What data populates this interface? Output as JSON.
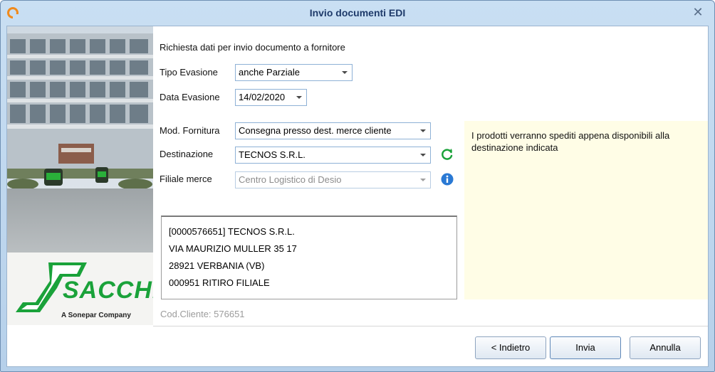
{
  "window": {
    "title": "Invio documenti EDI"
  },
  "form": {
    "heading": "Richiesta dati per invio documento a fornitore",
    "tipo_evasione": {
      "label": "Tipo Evasione",
      "value": "anche Parziale"
    },
    "data_evasione": {
      "label": "Data Evasione",
      "value": "14/02/2020"
    },
    "mod_fornitura": {
      "label": "Mod. Fornitura",
      "value": "Consegna presso dest. merce cliente"
    },
    "destinazione": {
      "label": "Destinazione",
      "value": "TECNOS S.R.L."
    },
    "filiale_merce": {
      "label": "Filiale merce",
      "value": "Centro Logistico di Desio"
    }
  },
  "info": {
    "text": "I prodotti verranno spediti appena disponibili alla destinazione indicata"
  },
  "address": {
    "line1": "[0000576651] TECNOS S.R.L.",
    "line2": "VIA MAURIZIO MULLER 35  17",
    "line3": "28921 VERBANIA (VB)",
    "line4": "000951 RITIRO FILIALE"
  },
  "cod_cliente": "Cod.Cliente: 576651",
  "logo": {
    "brand": "SACCHI",
    "tagline": "A Sonepar Company"
  },
  "buttons": {
    "back": "< Indietro",
    "send": "Invia",
    "cancel": "Annulla"
  },
  "colors": {
    "accent": "#1aa23a",
    "info_bg": "#fffde6",
    "title": "#1e3a6a",
    "info_icon": "#2a79d4"
  }
}
